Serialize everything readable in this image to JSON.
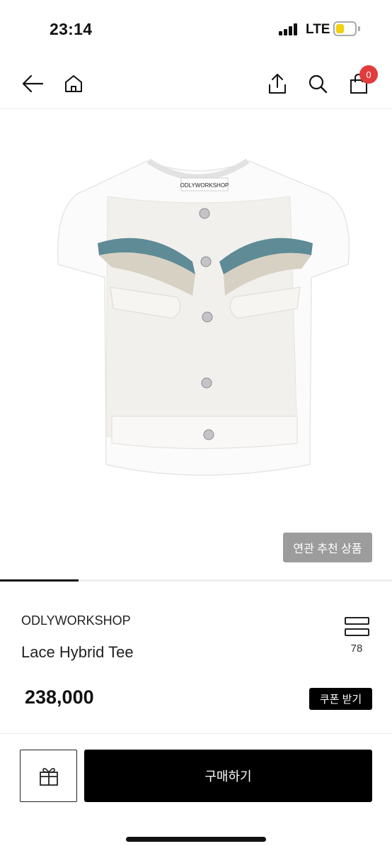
{
  "status_bar": {
    "time": "23:14",
    "network": "LTE",
    "battery_level": 0.3,
    "battery_color": "#f3d012"
  },
  "nav": {
    "back_icon": "arrow-left-icon",
    "home_icon": "home-icon",
    "share_icon": "share-icon",
    "search_icon": "search-icon",
    "cart_icon": "shopping-bag-icon",
    "cart_count": "0",
    "badge_color": "#e23b3b"
  },
  "product": {
    "image_label": "ODLYWORKSHOP",
    "related_button": "연관 추천 상품",
    "image_progress": 0.2,
    "brand": "ODLYWORKSHOP",
    "name": "Lace Hybrid Tee",
    "price": "238,000",
    "compare_icon": "compare-icon",
    "compare_count": "78",
    "coupon_button": "쿠폰 받기"
  },
  "bottom_bar": {
    "gift_icon": "gift-icon",
    "buy_button": "구매하기"
  }
}
